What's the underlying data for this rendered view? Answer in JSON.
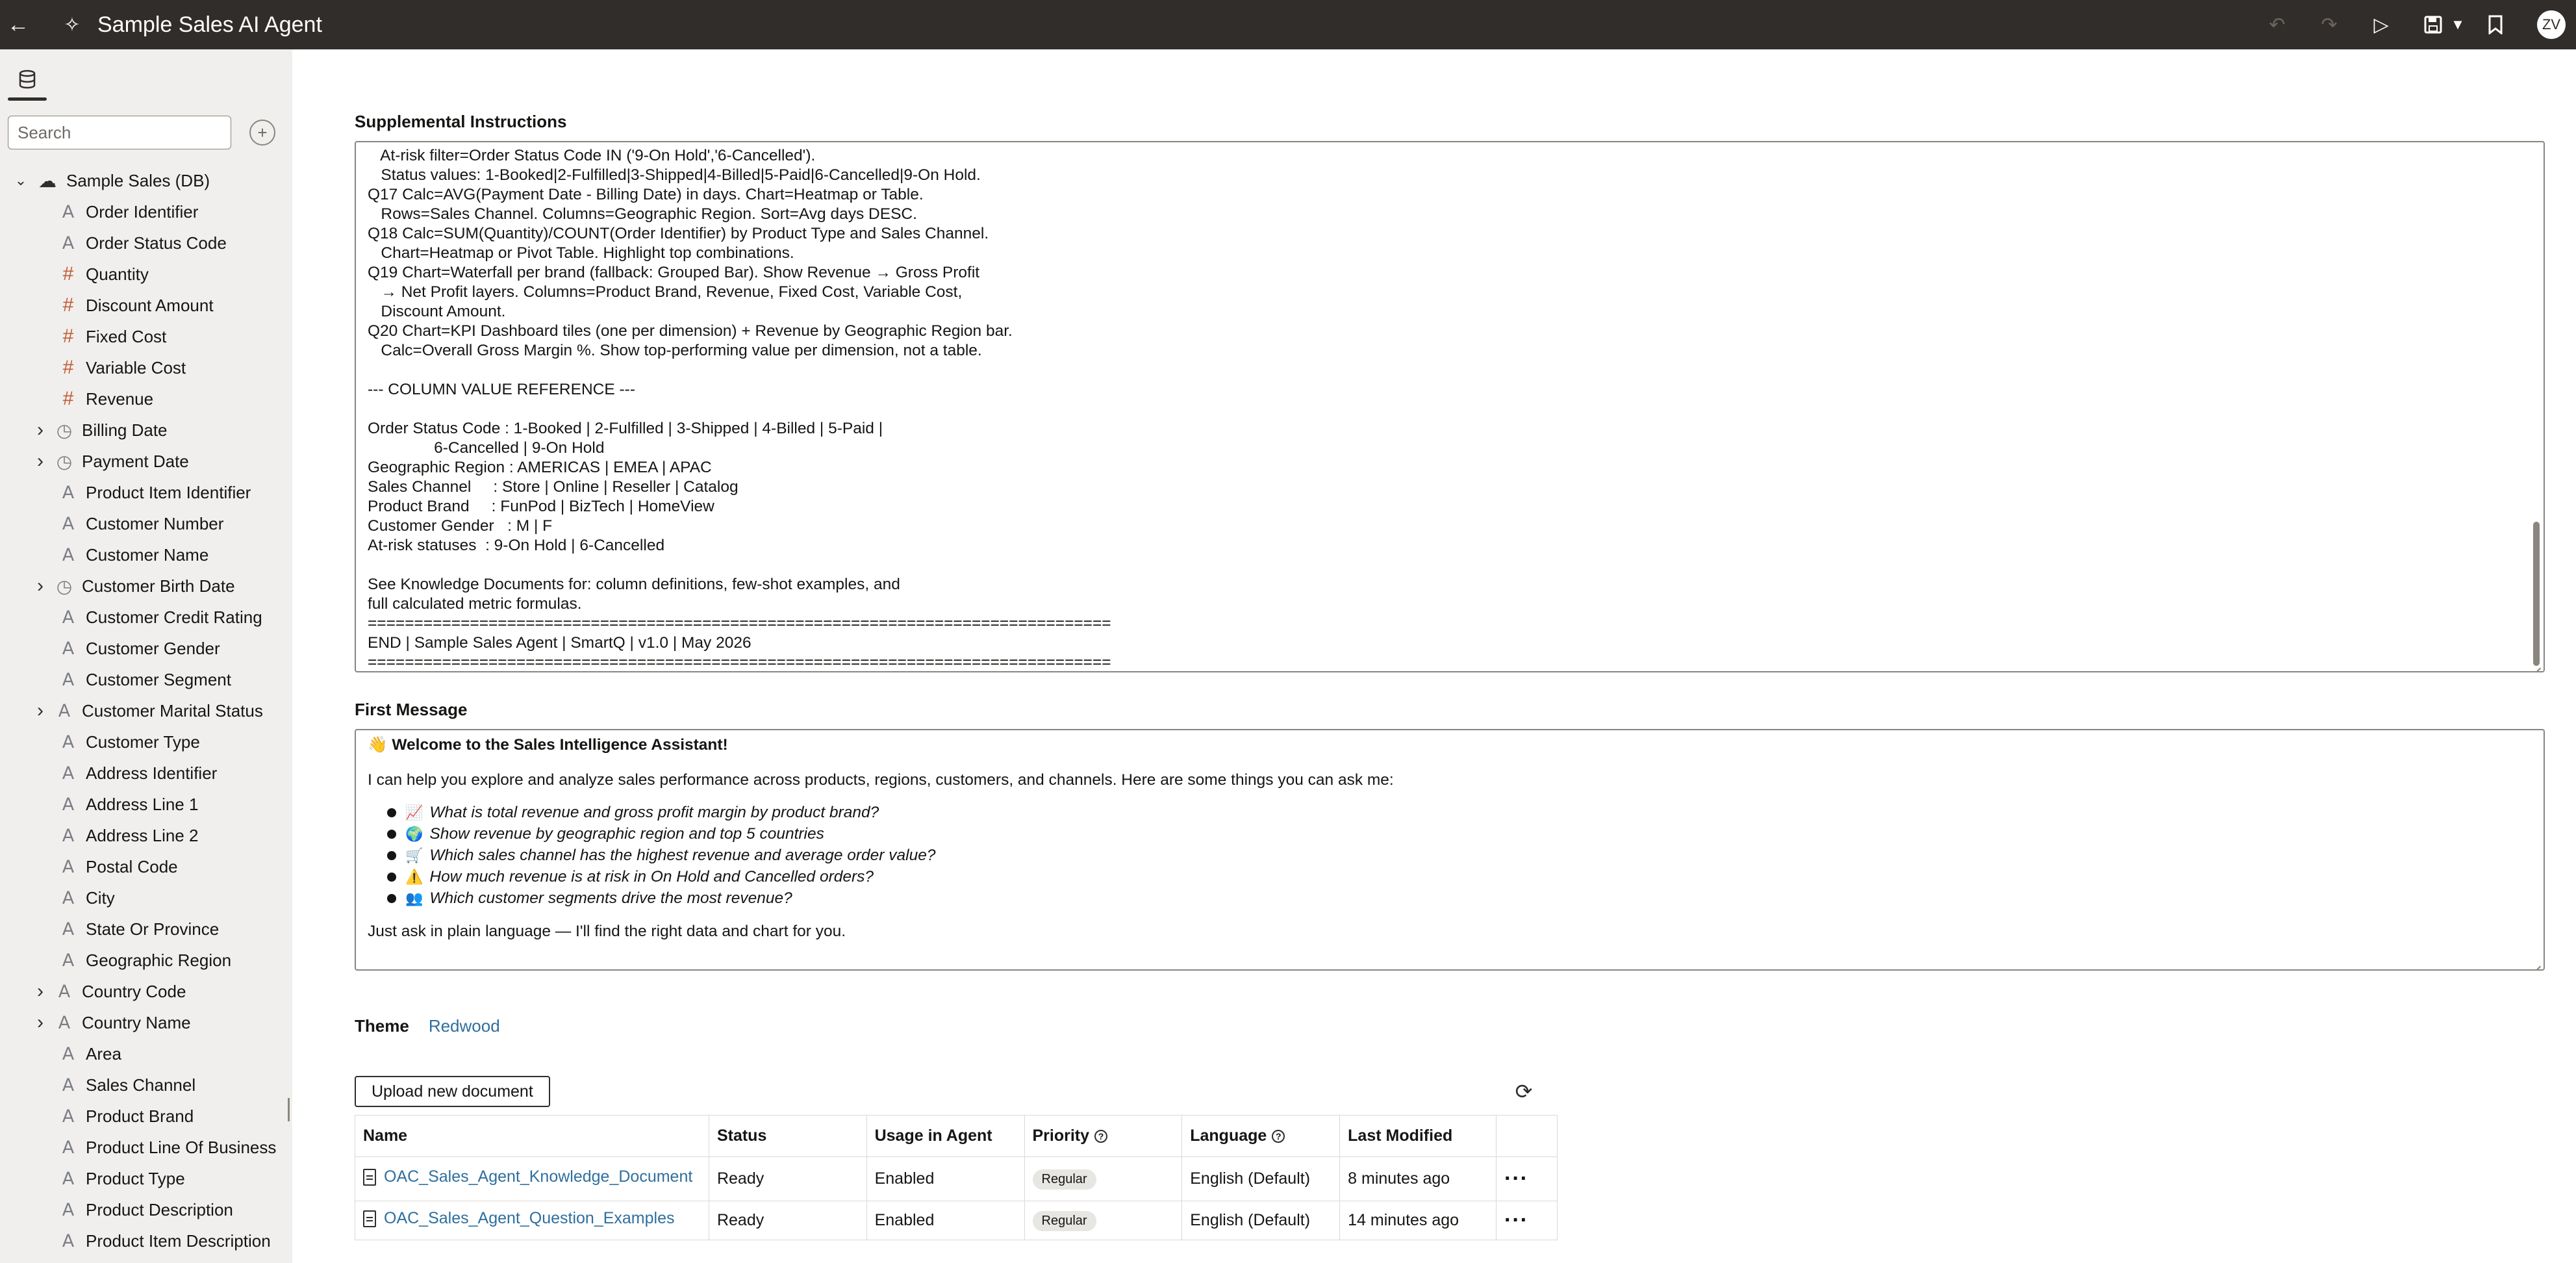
{
  "topbar": {
    "back_icon": "back-arrow-icon",
    "agent_icon": "ai-agent-icon",
    "title": "Sample Sales AI Agent",
    "avatar_initials": "ZV",
    "actions": [
      "undo-icon",
      "redo-icon",
      "run-icon",
      "save-icon",
      "bookmark-icon"
    ]
  },
  "sidebar": {
    "tab_icon": "database-icon",
    "search_placeholder": "Search",
    "root": {
      "label": "Sample Sales (DB)",
      "icon": "cloud-database-icon"
    },
    "items": [
      {
        "label": "Order Identifier",
        "type": "text",
        "expandable": false
      },
      {
        "label": "Order Status Code",
        "type": "text",
        "expandable": false
      },
      {
        "label": "Quantity",
        "type": "number",
        "expandable": false
      },
      {
        "label": "Discount Amount",
        "type": "number",
        "expandable": false
      },
      {
        "label": "Fixed Cost",
        "type": "number",
        "expandable": false
      },
      {
        "label": "Variable Cost",
        "type": "number",
        "expandable": false
      },
      {
        "label": "Revenue",
        "type": "number",
        "expandable": false
      },
      {
        "label": "Billing Date",
        "type": "date",
        "expandable": true
      },
      {
        "label": "Payment Date",
        "type": "date",
        "expandable": true
      },
      {
        "label": "Product Item Identifier",
        "type": "text",
        "expandable": false
      },
      {
        "label": "Customer Number",
        "type": "text",
        "expandable": false
      },
      {
        "label": "Customer Name",
        "type": "text",
        "expandable": false
      },
      {
        "label": "Customer Birth Date",
        "type": "date",
        "expandable": true
      },
      {
        "label": "Customer Credit Rating",
        "type": "text",
        "expandable": false
      },
      {
        "label": "Customer Gender",
        "type": "text",
        "expandable": false
      },
      {
        "label": "Customer Segment",
        "type": "text",
        "expandable": false
      },
      {
        "label": "Customer Marital Status",
        "type": "text",
        "expandable": true
      },
      {
        "label": "Customer Type",
        "type": "text",
        "expandable": false
      },
      {
        "label": "Address Identifier",
        "type": "text",
        "expandable": false
      },
      {
        "label": "Address Line 1",
        "type": "text",
        "expandable": false
      },
      {
        "label": "Address Line 2",
        "type": "text",
        "expandable": false
      },
      {
        "label": "Postal Code",
        "type": "text",
        "expandable": false
      },
      {
        "label": "City",
        "type": "text",
        "expandable": false
      },
      {
        "label": "State Or Province",
        "type": "text",
        "expandable": false
      },
      {
        "label": "Geographic Region",
        "type": "text",
        "expandable": false
      },
      {
        "label": "Country Code",
        "type": "text",
        "expandable": true
      },
      {
        "label": "Country Name",
        "type": "text",
        "expandable": true
      },
      {
        "label": "Area",
        "type": "text",
        "expandable": false
      },
      {
        "label": "Sales Channel",
        "type": "text",
        "expandable": false
      },
      {
        "label": "Product Brand",
        "type": "text",
        "expandable": false
      },
      {
        "label": "Product Line Of Business",
        "type": "text",
        "expandable": false
      },
      {
        "label": "Product Type",
        "type": "text",
        "expandable": false
      },
      {
        "label": "Product Description",
        "type": "text",
        "expandable": false
      },
      {
        "label": "Product Item Description",
        "type": "text",
        "expandable": false
      }
    ]
  },
  "supplemental": {
    "label": "Supplemental Instructions",
    "lines": [
      "   At-risk filter=Order Status Code IN ('9-On Hold','6-Cancelled').",
      "   Status values: 1-Booked|2-Fulfilled|3-Shipped|4-Billed|5-Paid|6-Cancelled|9-On Hold.",
      "Q17 Calc=AVG(Payment Date - Billing Date) in days. Chart=Heatmap or Table.",
      "   Rows=Sales Channel. Columns=Geographic Region. Sort=Avg days DESC.",
      "Q18 Calc=SUM(Quantity)/COUNT(Order Identifier) by Product Type and Sales Channel.",
      "   Chart=Heatmap or Pivot Table. Highlight top combinations.",
      "Q19 Chart=Waterfall per brand (fallback: Grouped Bar). Show Revenue → Gross Profit",
      "   → Net Profit layers. Columns=Product Brand, Revenue, Fixed Cost, Variable Cost,",
      "   Discount Amount.",
      "Q20 Chart=KPI Dashboard tiles (one per dimension) + Revenue by Geographic Region bar.",
      "   Calc=Overall Gross Margin %. Show top-performing value per dimension, not a table.",
      "",
      "--- COLUMN VALUE REFERENCE ---",
      "",
      "Order Status Code : 1-Booked | 2-Fulfilled | 3-Shipped | 4-Billed | 5-Paid |",
      "               6-Cancelled | 9-On Hold",
      "Geographic Region : AMERICAS | EMEA | APAC",
      "Sales Channel     : Store | Online | Reseller | Catalog",
      "Product Brand     : FunPod | BizTech | HomeView",
      "Customer Gender   : M | F",
      "At-risk statuses  : 9-On Hold | 6-Cancelled",
      "",
      "See Knowledge Documents for: column definitions, few-shot examples, and",
      "full calculated metric formulas.",
      "================================================================================",
      "END | Sample Sales Agent | SmartQ | v1.0 | May 2026",
      "================================================================================"
    ]
  },
  "first_message": {
    "label": "First Message",
    "title_emoji": "👋",
    "title": "Welcome to the Sales Intelligence Assistant!",
    "intro": "I can help you explore and analyze sales performance across products, regions, customers, and channels. Here are some things you can ask me:",
    "questions": [
      {
        "emoji": "📈",
        "text": "What is total revenue and gross profit margin by product brand?"
      },
      {
        "emoji": "🌍",
        "text": "Show revenue by geographic region and top 5 countries"
      },
      {
        "emoji": "🛒",
        "text": "Which sales channel has the highest revenue and average order value?"
      },
      {
        "emoji": "⚠️",
        "text": "How much revenue is at risk in On Hold and Cancelled orders?"
      },
      {
        "emoji": "👥",
        "text": "Which customer segments drive the most revenue?"
      }
    ],
    "outro": "Just ask in plain language — I'll find the right data and chart for you."
  },
  "theme": {
    "label": "Theme",
    "value": "Redwood"
  },
  "documents": {
    "upload_label": "Upload new document",
    "refresh_icon": "refresh-icon",
    "columns": [
      "Name",
      "Status",
      "Usage in Agent",
      "Priority",
      "Language",
      "Last Modified"
    ],
    "rows": [
      {
        "name": "OAC_Sales_Agent_Knowledge_Document",
        "status": "Ready",
        "usage": "Enabled",
        "priority": "Regular",
        "language": "English (Default)",
        "modified": "8 minutes ago",
        "more": "···"
      },
      {
        "name": "OAC_Sales_Agent_Question_Examples",
        "status": "Ready",
        "usage": "Enabled",
        "priority": "Regular",
        "language": "English (Default)",
        "modified": "14 minutes ago",
        "more": "···"
      }
    ]
  }
}
